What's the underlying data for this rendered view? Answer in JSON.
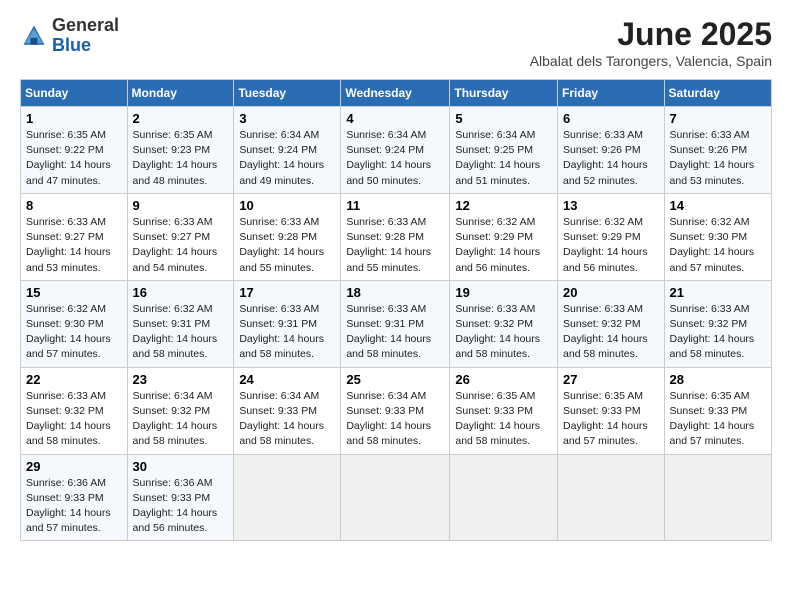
{
  "header": {
    "logo_general": "General",
    "logo_blue": "Blue",
    "month_year": "June 2025",
    "location": "Albalat dels Tarongers, Valencia, Spain"
  },
  "weekdays": [
    "Sunday",
    "Monday",
    "Tuesday",
    "Wednesday",
    "Thursday",
    "Friday",
    "Saturday"
  ],
  "weeks": [
    [
      {
        "day": "1",
        "sunrise": "6:35 AM",
        "sunset": "9:22 PM",
        "daylight": "14 hours and 47 minutes."
      },
      {
        "day": "2",
        "sunrise": "6:35 AM",
        "sunset": "9:23 PM",
        "daylight": "14 hours and 48 minutes."
      },
      {
        "day": "3",
        "sunrise": "6:34 AM",
        "sunset": "9:24 PM",
        "daylight": "14 hours and 49 minutes."
      },
      {
        "day": "4",
        "sunrise": "6:34 AM",
        "sunset": "9:24 PM",
        "daylight": "14 hours and 50 minutes."
      },
      {
        "day": "5",
        "sunrise": "6:34 AM",
        "sunset": "9:25 PM",
        "daylight": "14 hours and 51 minutes."
      },
      {
        "day": "6",
        "sunrise": "6:33 AM",
        "sunset": "9:26 PM",
        "daylight": "14 hours and 52 minutes."
      },
      {
        "day": "7",
        "sunrise": "6:33 AM",
        "sunset": "9:26 PM",
        "daylight": "14 hours and 53 minutes."
      }
    ],
    [
      {
        "day": "8",
        "sunrise": "6:33 AM",
        "sunset": "9:27 PM",
        "daylight": "14 hours and 53 minutes."
      },
      {
        "day": "9",
        "sunrise": "6:33 AM",
        "sunset": "9:27 PM",
        "daylight": "14 hours and 54 minutes."
      },
      {
        "day": "10",
        "sunrise": "6:33 AM",
        "sunset": "9:28 PM",
        "daylight": "14 hours and 55 minutes."
      },
      {
        "day": "11",
        "sunrise": "6:33 AM",
        "sunset": "9:28 PM",
        "daylight": "14 hours and 55 minutes."
      },
      {
        "day": "12",
        "sunrise": "6:32 AM",
        "sunset": "9:29 PM",
        "daylight": "14 hours and 56 minutes."
      },
      {
        "day": "13",
        "sunrise": "6:32 AM",
        "sunset": "9:29 PM",
        "daylight": "14 hours and 56 minutes."
      },
      {
        "day": "14",
        "sunrise": "6:32 AM",
        "sunset": "9:30 PM",
        "daylight": "14 hours and 57 minutes."
      }
    ],
    [
      {
        "day": "15",
        "sunrise": "6:32 AM",
        "sunset": "9:30 PM",
        "daylight": "14 hours and 57 minutes."
      },
      {
        "day": "16",
        "sunrise": "6:32 AM",
        "sunset": "9:31 PM",
        "daylight": "14 hours and 58 minutes."
      },
      {
        "day": "17",
        "sunrise": "6:33 AM",
        "sunset": "9:31 PM",
        "daylight": "14 hours and 58 minutes."
      },
      {
        "day": "18",
        "sunrise": "6:33 AM",
        "sunset": "9:31 PM",
        "daylight": "14 hours and 58 minutes."
      },
      {
        "day": "19",
        "sunrise": "6:33 AM",
        "sunset": "9:32 PM",
        "daylight": "14 hours and 58 minutes."
      },
      {
        "day": "20",
        "sunrise": "6:33 AM",
        "sunset": "9:32 PM",
        "daylight": "14 hours and 58 minutes."
      },
      {
        "day": "21",
        "sunrise": "6:33 AM",
        "sunset": "9:32 PM",
        "daylight": "14 hours and 58 minutes."
      }
    ],
    [
      {
        "day": "22",
        "sunrise": "6:33 AM",
        "sunset": "9:32 PM",
        "daylight": "14 hours and 58 minutes."
      },
      {
        "day": "23",
        "sunrise": "6:34 AM",
        "sunset": "9:32 PM",
        "daylight": "14 hours and 58 minutes."
      },
      {
        "day": "24",
        "sunrise": "6:34 AM",
        "sunset": "9:33 PM",
        "daylight": "14 hours and 58 minutes."
      },
      {
        "day": "25",
        "sunrise": "6:34 AM",
        "sunset": "9:33 PM",
        "daylight": "14 hours and 58 minutes."
      },
      {
        "day": "26",
        "sunrise": "6:35 AM",
        "sunset": "9:33 PM",
        "daylight": "14 hours and 58 minutes."
      },
      {
        "day": "27",
        "sunrise": "6:35 AM",
        "sunset": "9:33 PM",
        "daylight": "14 hours and 57 minutes."
      },
      {
        "day": "28",
        "sunrise": "6:35 AM",
        "sunset": "9:33 PM",
        "daylight": "14 hours and 57 minutes."
      }
    ],
    [
      {
        "day": "29",
        "sunrise": "6:36 AM",
        "sunset": "9:33 PM",
        "daylight": "14 hours and 57 minutes."
      },
      {
        "day": "30",
        "sunrise": "6:36 AM",
        "sunset": "9:33 PM",
        "daylight": "14 hours and 56 minutes."
      },
      null,
      null,
      null,
      null,
      null
    ]
  ]
}
